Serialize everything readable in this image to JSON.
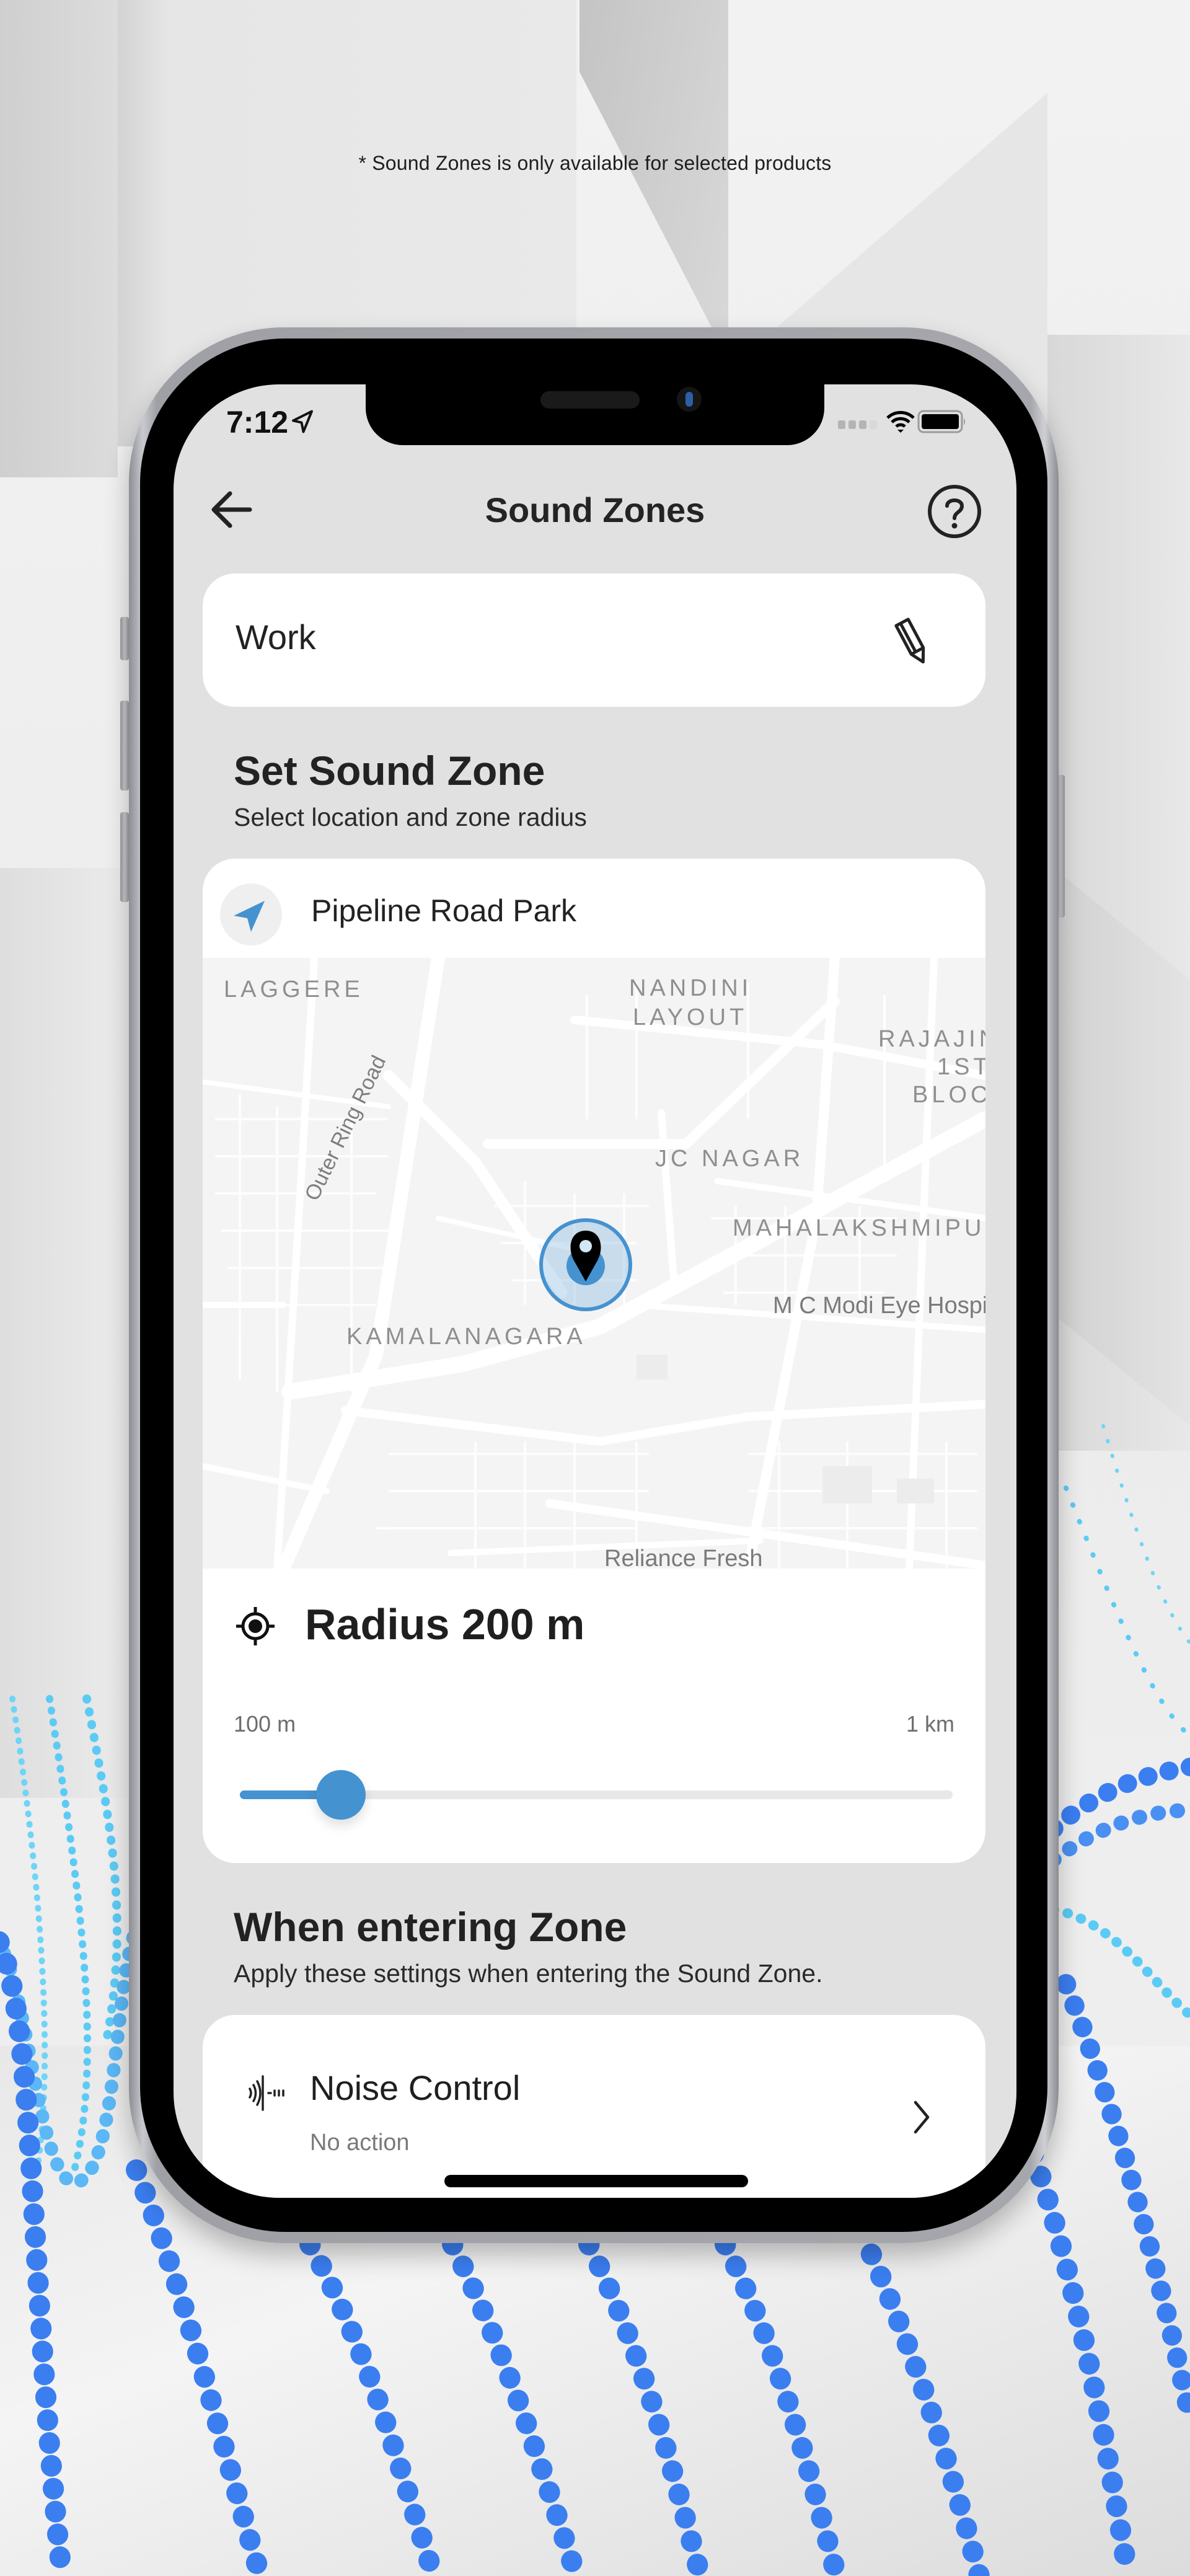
{
  "footnote": "* Sound Zones is only available for selected products",
  "status_bar": {
    "time": "7:12",
    "location_services_icon": "location-arrow-icon",
    "signal_icon": "cellular-signal-icon",
    "wifi_icon": "wifi-icon",
    "battery_icon": "battery-icon"
  },
  "nav": {
    "back_icon": "arrow-left-icon",
    "title": "Sound Zones",
    "help_icon": "question-circle-icon"
  },
  "zone_name": {
    "value": "Work",
    "edit_icon": "pencil-icon"
  },
  "set_zone": {
    "title": "Set Sound Zone",
    "subtitle": "Select location and zone radius",
    "location": {
      "name": "Pipeline Road Park",
      "icon": "navigation-arrow-icon"
    },
    "map": {
      "labels": [
        "LAGGERE",
        "NANDINI",
        "LAYOUT",
        "RAJAJIN",
        "1ST",
        "BLOC",
        "JC NAGAR",
        "MAHALAKSHMIPU",
        "KAMALANAGARA"
      ],
      "road_label": "Outer Ring Road",
      "pois": [
        "M C Modi Eye Hospita",
        "Reliance Fresh"
      ],
      "marker_icon": "map-pin-icon"
    },
    "radius": {
      "icon": "crosshair-target-icon",
      "label": "Radius 200 m",
      "value_m": 200,
      "min_label": "100 m",
      "max_label": "1 km",
      "min_m": 100,
      "max_m": 1000
    }
  },
  "entering_zone": {
    "title": "When entering Zone",
    "subtitle": "Apply these settings when entering the Sound Zone.",
    "items": [
      {
        "title": "Noise Control",
        "value": "No action",
        "icon": "noise-control-icon",
        "chevron_icon": "chevron-right-icon"
      }
    ]
  },
  "colors": {
    "accent": "#4592D0",
    "screen_bg": "#E1E1E1",
    "card_bg": "#FFFFFF",
    "text_primary": "#222222",
    "text_secondary": "#7A7A7A",
    "wave_blue": "#3B7EF0",
    "wave_light": "#5BCBF5"
  }
}
